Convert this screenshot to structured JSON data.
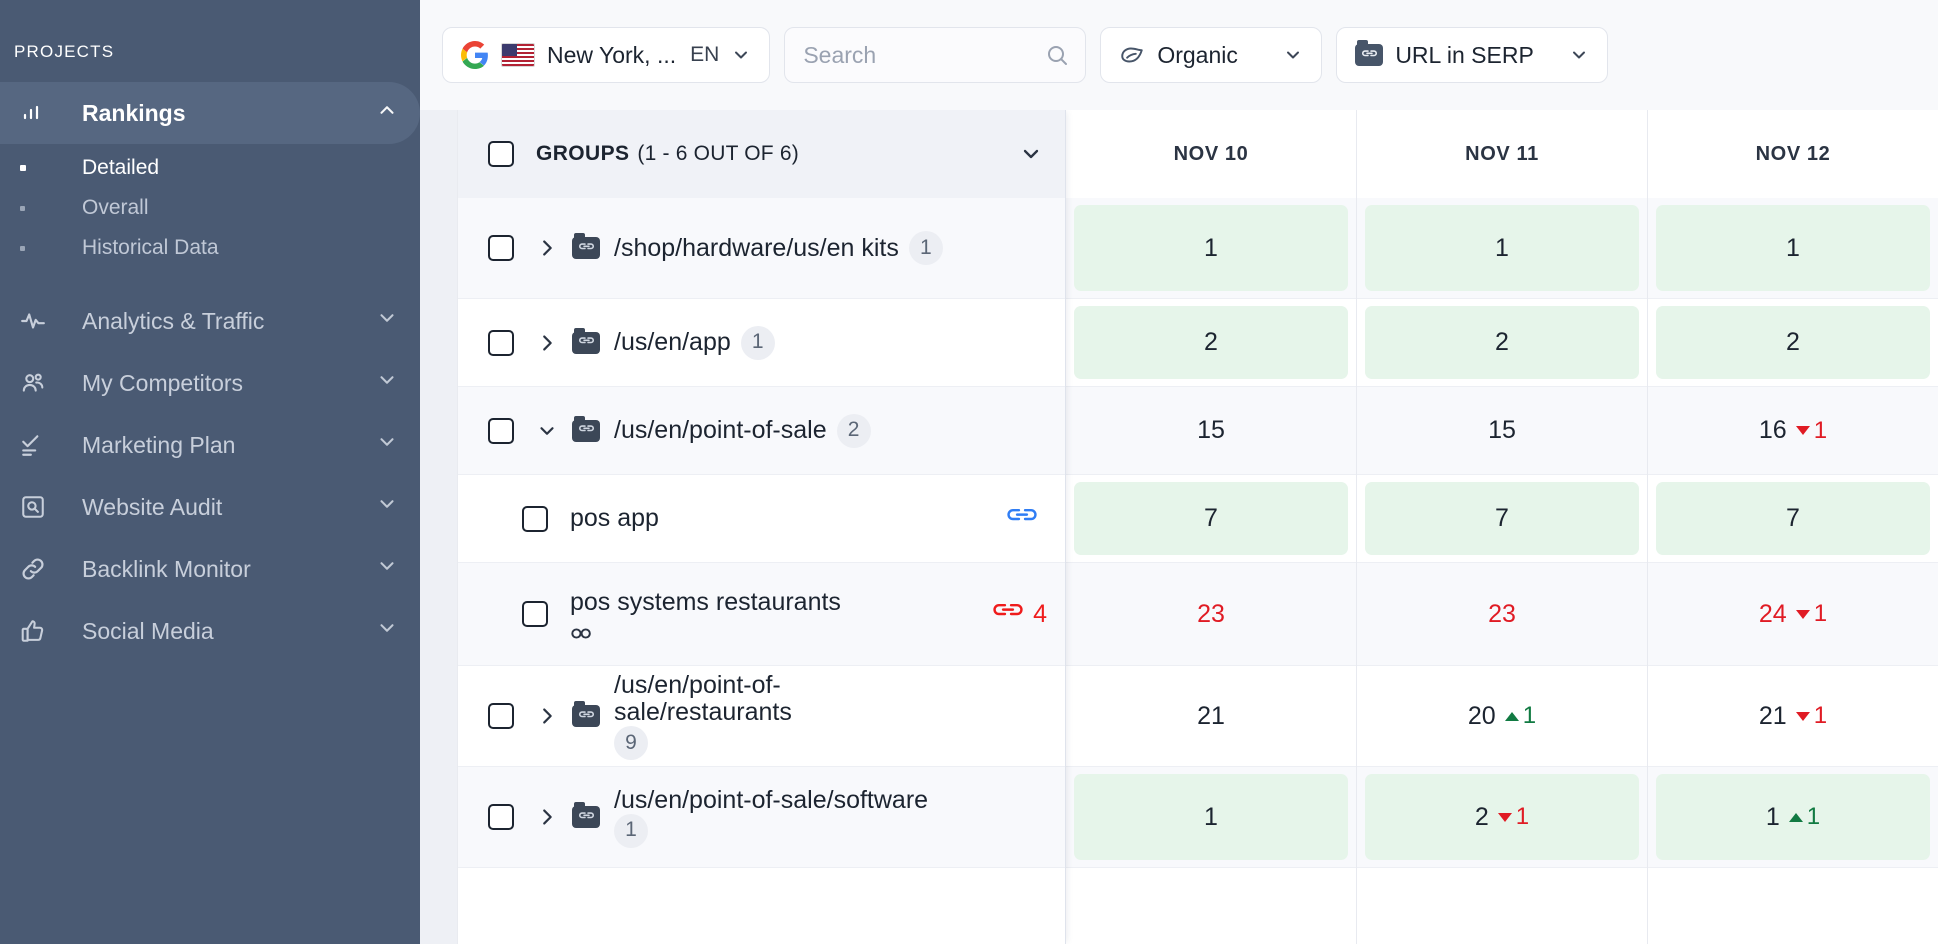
{
  "sidebar": {
    "section_label": "PROJECTS",
    "items": [
      {
        "label": "Rankings",
        "icon": "bar-chart-icon",
        "active": true,
        "expanded": true,
        "children": [
          {
            "label": "Detailed",
            "active": true
          },
          {
            "label": "Overall",
            "active": false
          },
          {
            "label": "Historical Data",
            "active": false
          }
        ]
      },
      {
        "label": "Analytics & Traffic",
        "icon": "pulse-icon",
        "active": false,
        "expanded": false
      },
      {
        "label": "My Competitors",
        "icon": "users-icon",
        "active": false,
        "expanded": false
      },
      {
        "label": "Marketing Plan",
        "icon": "checklist-icon",
        "active": false,
        "expanded": false
      },
      {
        "label": "Website Audit",
        "icon": "magnifier-box-icon",
        "active": false,
        "expanded": false
      },
      {
        "label": "Backlink Monitor",
        "icon": "link-icon",
        "active": false,
        "expanded": false
      },
      {
        "label": "Social Media",
        "icon": "thumbs-up-icon",
        "active": false,
        "expanded": false
      }
    ]
  },
  "toolbar": {
    "engine_icon": "google-logo-icon",
    "flag_icon": "us-flag-icon",
    "location": "New York, ...",
    "language": "EN",
    "search_placeholder": "Search",
    "search_value": "",
    "search_icon": "search-icon",
    "result_type": "Organic",
    "result_type_icon": "leaf-icon",
    "serp_mode": "URL in SERP",
    "serp_mode_icon": "folder-link-icon"
  },
  "table": {
    "groups_header": "GROUPS",
    "groups_count": "(1 - 6 OUT OF 6)",
    "date_columns": [
      "NOV 10",
      "NOV 11",
      "NOV 12"
    ],
    "rows": [
      {
        "type": "group",
        "label": "/shop/hardware/us/en kits",
        "badge": "1",
        "expanded": false,
        "alt": true,
        "height": "h2",
        "cells": [
          {
            "value": "1",
            "highlight": true,
            "delta": null,
            "dir": null,
            "red": false
          },
          {
            "value": "1",
            "highlight": true,
            "delta": null,
            "dir": null,
            "red": false
          },
          {
            "value": "1",
            "highlight": true,
            "delta": null,
            "dir": null,
            "red": false
          }
        ]
      },
      {
        "type": "group",
        "label": "/us/en/app",
        "badge": "1",
        "expanded": false,
        "alt": false,
        "height": "h1",
        "cells": [
          {
            "value": "2",
            "highlight": true,
            "delta": null,
            "dir": null,
            "red": false
          },
          {
            "value": "2",
            "highlight": true,
            "delta": null,
            "dir": null,
            "red": false
          },
          {
            "value": "2",
            "highlight": true,
            "delta": null,
            "dir": null,
            "red": false
          }
        ]
      },
      {
        "type": "group",
        "label": "/us/en/point-of-sale",
        "badge": "2",
        "expanded": true,
        "alt": true,
        "height": "h1",
        "cells": [
          {
            "value": "15",
            "highlight": false,
            "delta": null,
            "dir": null,
            "red": false
          },
          {
            "value": "15",
            "highlight": false,
            "delta": null,
            "dir": null,
            "red": false
          },
          {
            "value": "16",
            "highlight": false,
            "delta": "1",
            "dir": "down",
            "red": false
          }
        ]
      },
      {
        "type": "keyword",
        "label": "pos app",
        "link_count": "",
        "link_color": "blue",
        "link_icon": "link-icon",
        "has_sub_icon": false,
        "alt": false,
        "height": "h1",
        "cells": [
          {
            "value": "7",
            "highlight": true,
            "delta": null,
            "dir": null,
            "red": false
          },
          {
            "value": "7",
            "highlight": true,
            "delta": null,
            "dir": null,
            "red": false
          },
          {
            "value": "7",
            "highlight": true,
            "delta": null,
            "dir": null,
            "red": false
          }
        ]
      },
      {
        "type": "keyword",
        "label": "pos systems restaurants",
        "link_count": "4",
        "link_color": "red",
        "link_icon": "link-icon",
        "has_sub_icon": true,
        "sub_icon": "link-small-icon",
        "alt": true,
        "height": "h3",
        "cells": [
          {
            "value": "23",
            "highlight": false,
            "delta": null,
            "dir": null,
            "red": true
          },
          {
            "value": "23",
            "highlight": false,
            "delta": null,
            "dir": null,
            "red": true
          },
          {
            "value": "24",
            "highlight": false,
            "delta": "1",
            "dir": "down",
            "red": true
          }
        ]
      },
      {
        "type": "group",
        "label": "/us/en/point-of-sale/restaurants",
        "badge": "9",
        "expanded": false,
        "alt": false,
        "height": "h2",
        "cells": [
          {
            "value": "21",
            "highlight": false,
            "delta": null,
            "dir": null,
            "red": false
          },
          {
            "value": "20",
            "highlight": false,
            "delta": "1",
            "dir": "up",
            "red": false
          },
          {
            "value": "21",
            "highlight": false,
            "delta": "1",
            "dir": "down",
            "red": false
          }
        ]
      },
      {
        "type": "group",
        "label": "/us/en/point-of-sale/software",
        "badge": "1",
        "expanded": false,
        "alt": true,
        "height": "h2",
        "cells": [
          {
            "value": "1",
            "highlight": true,
            "delta": null,
            "dir": null,
            "red": false
          },
          {
            "value": "2",
            "highlight": true,
            "delta": "1",
            "dir": "down",
            "red": false
          },
          {
            "value": "1",
            "highlight": true,
            "delta": "1",
            "dir": "up",
            "red": false
          }
        ]
      }
    ]
  },
  "colors": {
    "sidebar_bg": "#4a5a73",
    "sidebar_active": "#566781",
    "highlight_green": "#e6f5ea",
    "down_red": "#e01b24",
    "up_green": "#117a42",
    "link_blue": "#2f7df4",
    "link_red": "#ef1c1c"
  }
}
